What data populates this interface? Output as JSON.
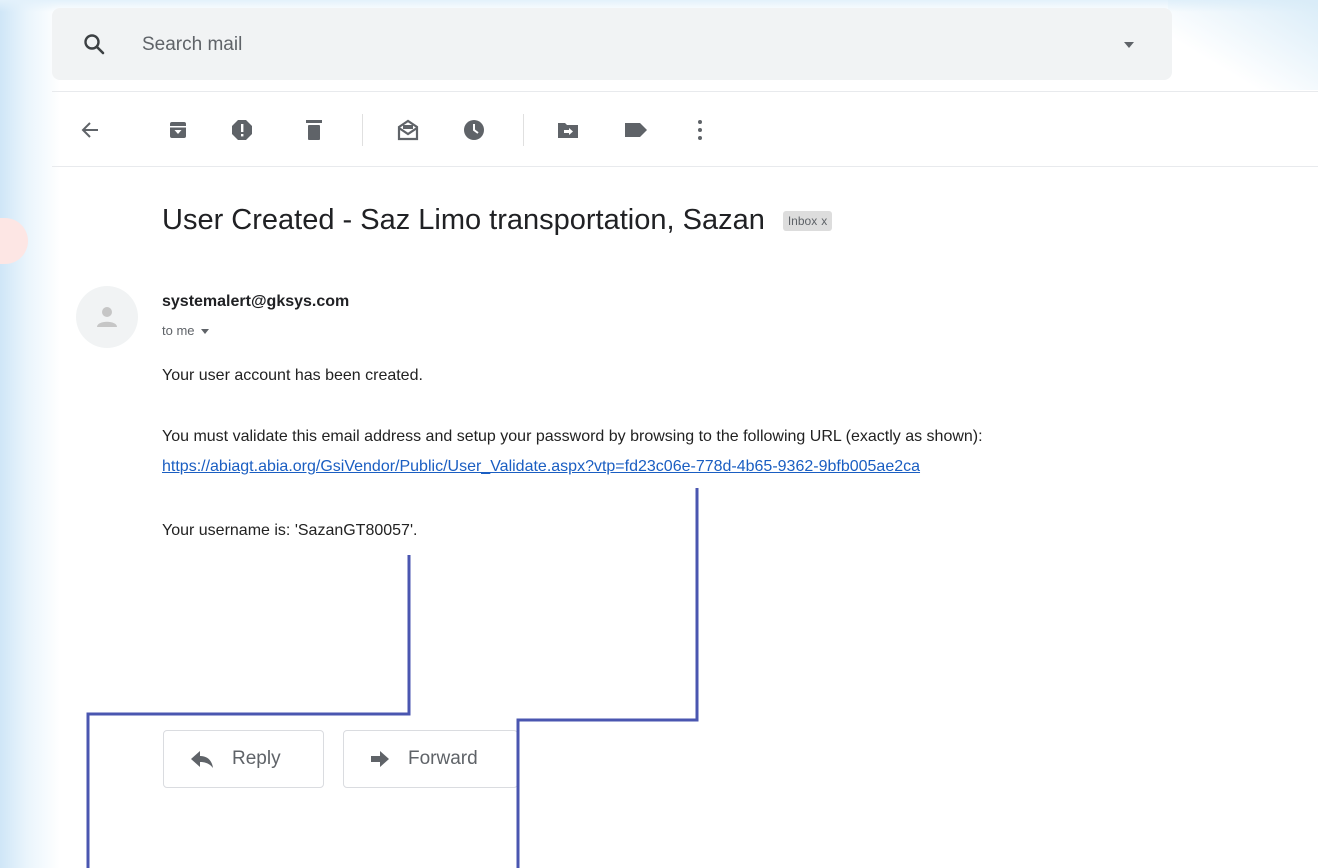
{
  "search": {
    "placeholder": "Search mail"
  },
  "toolbar": {
    "icons": [
      "back-arrow-icon",
      "archive-icon",
      "report-spam-icon",
      "delete-icon",
      "mark-unread-icon",
      "snooze-icon",
      "move-to-icon",
      "labels-icon",
      "more-vert-icon"
    ]
  },
  "email": {
    "subject": "User Created - Saz Limo transportation, Sazan",
    "label": "Inbox",
    "label_close": "x",
    "sender": "systemalert@gksys.com",
    "recipient": "to me",
    "body": {
      "line1": "Your user account has been created.",
      "line2": "You must validate this email address and setup your password by browsing to the following URL (exactly as shown):",
      "link": "https://abiagt.abia.org/GsiVendor/Public/User_Validate.aspx?vtp=fd23c06e-778d-4b65-9362-9bfb005ae2ca",
      "line3": "Your username is: 'SazanGT80057'."
    }
  },
  "actions": {
    "reply_label": "Reply",
    "forward_label": "Forward"
  },
  "colors": {
    "annotation_line": "#4a56b0",
    "link": "#1a5ec2"
  }
}
